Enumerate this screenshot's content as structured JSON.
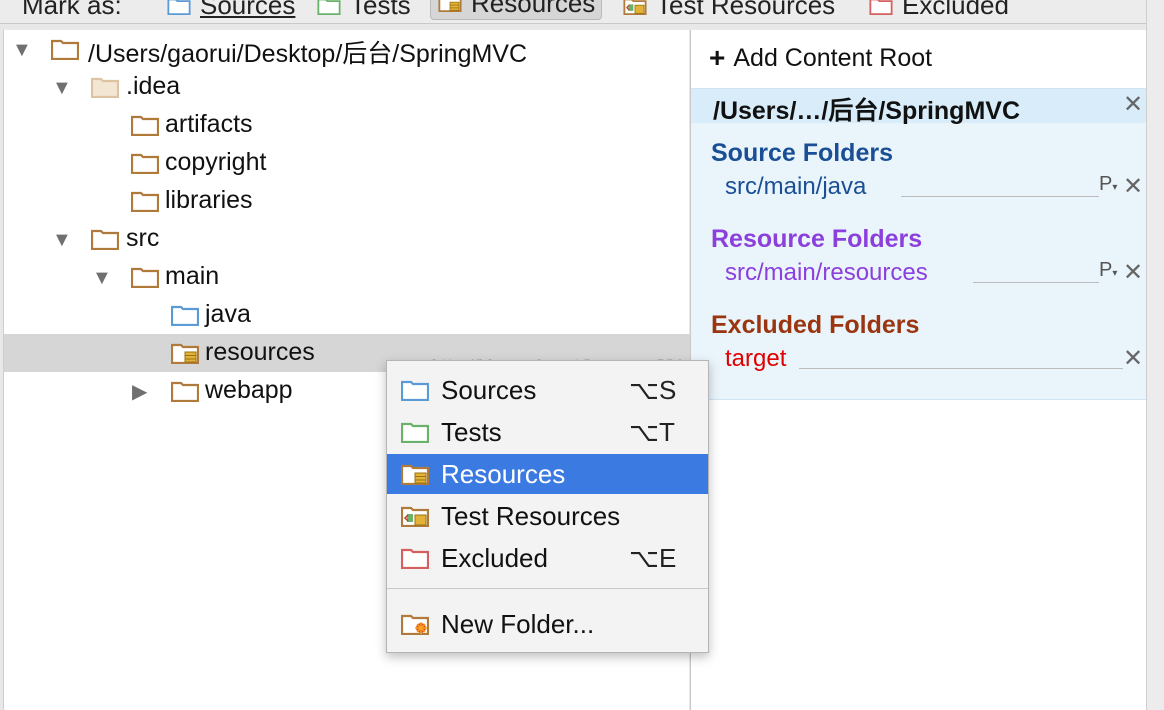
{
  "mark_as": {
    "label": "Mark as:",
    "buttons": [
      {
        "label": "Sources",
        "icon": "folder-sources-icon",
        "color": "#5b9bd5"
      },
      {
        "label": "Tests",
        "icon": "folder-tests-icon",
        "color": "#6ab26a"
      },
      {
        "label": "Resources",
        "icon": "folder-resources-icon",
        "color": "#c89a57",
        "active": true
      },
      {
        "label": "Test Resources",
        "icon": "folder-test-resources-icon",
        "color": "#c89a57"
      },
      {
        "label": "Excluded",
        "icon": "folder-excluded-icon",
        "color": "#d66060"
      }
    ]
  },
  "tree": {
    "root": "/Users/gaorui/Desktop/后台/SpringMVC",
    "items": [
      {
        "label": ".idea",
        "icon": "folder-icon-faded"
      },
      {
        "label": "artifacts",
        "icon": "folder-icon"
      },
      {
        "label": "copyright",
        "icon": "folder-icon"
      },
      {
        "label": "libraries",
        "icon": "folder-icon"
      },
      {
        "label": "src",
        "icon": "folder-icon"
      },
      {
        "label": "main",
        "icon": "folder-icon"
      },
      {
        "label": "java",
        "icon": "folder-sources-icon"
      },
      {
        "label": "resources",
        "icon": "folder-resources-icon"
      },
      {
        "label": "webapp",
        "icon": "folder-icon"
      }
    ]
  },
  "content_root": {
    "add_label": "Add Content Root",
    "path": "/Users/…/后台/SpringMVC",
    "sections": {
      "source": {
        "title": "Source Folders",
        "color": "#1a4f96",
        "entry": "src/main/java",
        "entry_color": "#1a4f96"
      },
      "resource": {
        "title": "Resource Folders",
        "color": "#8b3fdc",
        "entry": "src/main/resources",
        "entry_color": "#8b3fdc"
      },
      "excluded": {
        "title": "Excluded Folders",
        "color": "#9a3510",
        "entry": "target",
        "entry_color": "#e00000"
      }
    },
    "p_button": "P"
  },
  "context_menu": {
    "items": [
      {
        "label": "Sources",
        "shortcut": "⌥S",
        "icon": "folder-sources-icon"
      },
      {
        "label": "Tests",
        "shortcut": "⌥T",
        "icon": "folder-tests-icon"
      },
      {
        "label": "Resources",
        "shortcut": "",
        "icon": "folder-resources-icon",
        "highlighted": true
      },
      {
        "label": "Test Resources",
        "shortcut": "",
        "icon": "folder-test-resources-icon"
      },
      {
        "label": "Excluded",
        "shortcut": "⌥E",
        "icon": "folder-excluded-icon"
      },
      {
        "label": "New Folder...",
        "shortcut": "",
        "icon": "new-folder-icon"
      }
    ]
  },
  "watermark": "http://blog.csdn.net/brycegao321"
}
